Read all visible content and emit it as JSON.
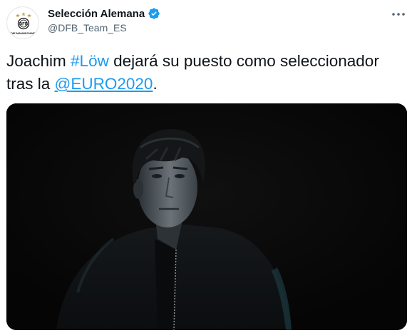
{
  "account": {
    "display_name": "Selección Alemana",
    "handle": "@DFB_Team_ES",
    "avatar_icon": "dfb-crest-icon",
    "avatar_text": "DIE MANNSCHAFT",
    "verified_icon": "verified-badge-icon",
    "verified_color": "#1d9bf0"
  },
  "tweet": {
    "text_part1": "Joachim ",
    "hashtag": "#Löw",
    "text_part2": " dejará su puesto como seleccionador tras la ",
    "mention": "@EURO2020",
    "text_part3": "."
  },
  "media": {
    "image_icon": "portrait-photo",
    "background_color": "#070707"
  },
  "more_icon": "more-options-icon",
  "colors": {
    "link": "#1d9bf0",
    "text": "#0f1419",
    "secondary_text": "#536471"
  }
}
